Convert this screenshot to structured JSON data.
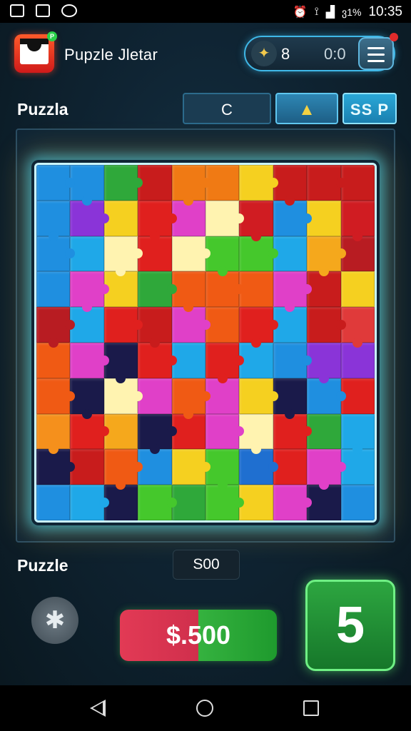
{
  "status_bar": {
    "time": "10:35",
    "battery": "ვ1%"
  },
  "header": {
    "app_title": "Pupzle Jletar",
    "app_badge": "P",
    "score": "8",
    "timer": "0:0",
    "gem_icon": "feather-gem-icon",
    "menu_icon": "hamburger-icon"
  },
  "toolbar": {
    "section_label": "Puzzla",
    "tab_c_label": "C",
    "tab_hat_icon": "hat-icon",
    "tab_ssp_label": "SS P"
  },
  "board": {
    "rows": 10,
    "cols": 10,
    "tiles": [
      [
        "#1f8fe0",
        "#1f8fe0",
        "#2fa83a",
        "#c81c1c",
        "#f07a14",
        "#f07a14",
        "#f5d020",
        "#c81c1c",
        "#c81c1c",
        "#c81c1c"
      ],
      [
        "#1f8fe0",
        "#8a34d8",
        "#f5d020",
        "#e0201e",
        "#e040c8",
        "#fff3b0",
        "#d01c22",
        "#1f8fe0",
        "#f5d020",
        "#d01c22"
      ],
      [
        "#1f8fe0",
        "#1fa8e8",
        "#fff3b0",
        "#e0201e",
        "#fff3b0",
        "#45c82c",
        "#45c82c",
        "#1fa8e8",
        "#f5a81c",
        "#b81c22"
      ],
      [
        "#1f8fe0",
        "#e040c8",
        "#f5d020",
        "#2fa83a",
        "#f05a14",
        "#f05a14",
        "#f05a14",
        "#e040c8",
        "#c81c1c",
        "#f5d020"
      ],
      [
        "#b81c22",
        "#1fa8e8",
        "#e0201e",
        "#c81c1c",
        "#e040c8",
        "#f05a14",
        "#e0201e",
        "#1fa8e8",
        "#c81c1c",
        "#e03a3a"
      ],
      [
        "#f05a14",
        "#e040c8",
        "#1a1a4a",
        "#e0201e",
        "#1fa8e8",
        "#e0201e",
        "#1fa8e8",
        "#1f8fe0",
        "#8a34d8",
        "#8a34d8"
      ],
      [
        "#f05a14",
        "#1a1a4a",
        "#fff3b0",
        "#e040c8",
        "#f05a14",
        "#e040c8",
        "#f5d020",
        "#1a1a4a",
        "#1f8fe0",
        "#e0201e"
      ],
      [
        "#f5901c",
        "#e0201e",
        "#f5a81c",
        "#1a1a4a",
        "#e0201e",
        "#e040c8",
        "#fff3b0",
        "#e0201e",
        "#2fa83a",
        "#1fa8e8"
      ],
      [
        "#1a1a4a",
        "#c81c1c",
        "#f05a14",
        "#1f8fe0",
        "#f5d020",
        "#45c82c",
        "#1f6fd0",
        "#e0201e",
        "#e040c8",
        "#1fa8e8"
      ],
      [
        "#1f8fe0",
        "#1fa8e8",
        "#1a1a4a",
        "#45c82c",
        "#2fa83a",
        "#45c82c",
        "#f5d020",
        "#e040c8",
        "#1a1a4a",
        "#1f8fe0"
      ]
    ]
  },
  "bottom": {
    "section_label": "Puzzle",
    "score_chip": "S00",
    "price_label": "$.500",
    "level_label": "5",
    "hint_icon": "star-hint-icon"
  },
  "colors": {
    "accent": "#3fb8e8",
    "price_red": "#e23a55",
    "price_green": "#35b23f",
    "level_green": "#2da640"
  }
}
